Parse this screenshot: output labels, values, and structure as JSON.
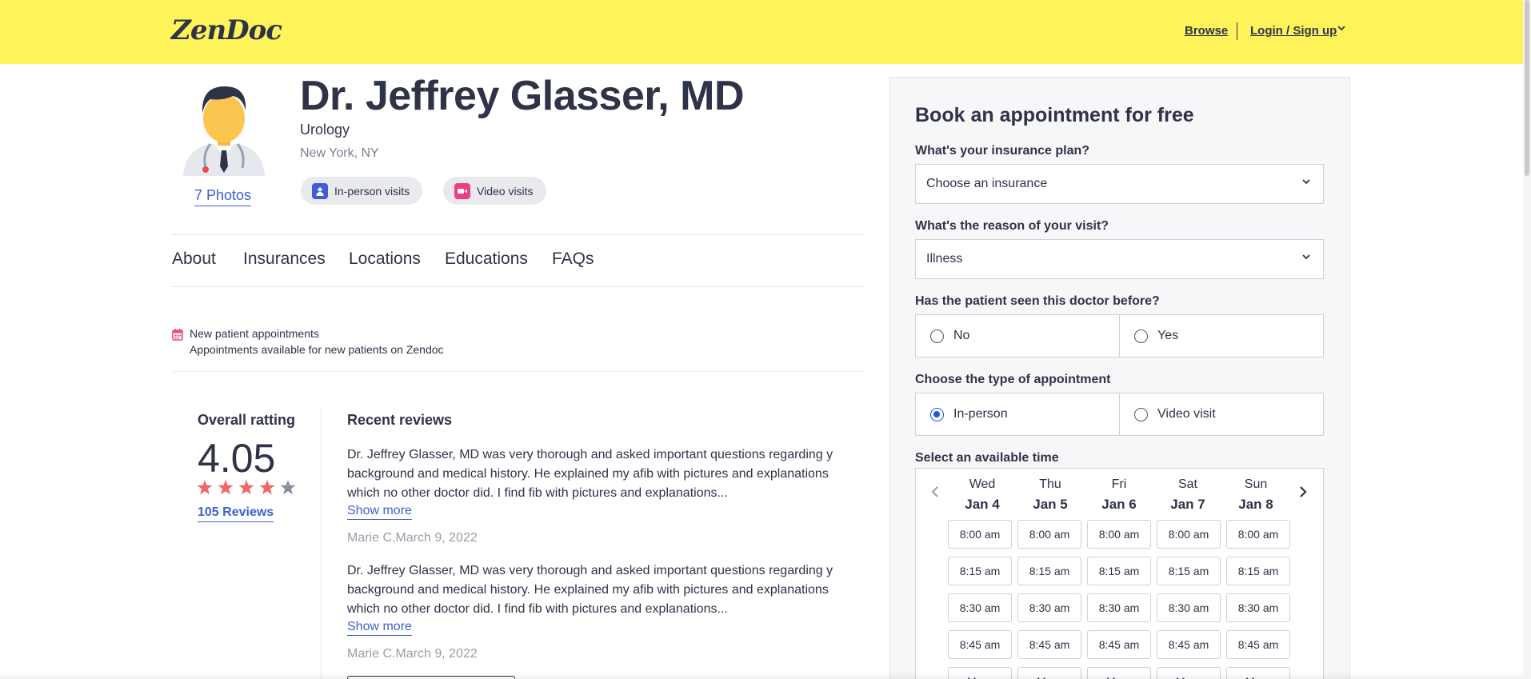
{
  "header": {
    "logo": "ZenDoc",
    "browse": "Browse",
    "login": "Login / Sign up"
  },
  "profile": {
    "name": "Dr. Jeffrey Glasser, MD",
    "specialty": "Urology",
    "location": "New York, NY",
    "photos": "7 Photos",
    "chips": [
      "In-person visits",
      "Video visits"
    ]
  },
  "tabs": [
    "About",
    "Insurances",
    "Locations",
    "Educations",
    "FAQs"
  ],
  "new_patient": {
    "title": "New patient appointments",
    "subtitle": "Appointments available for new patients on Zendoc"
  },
  "rating": {
    "title": "Overall ratting",
    "value": "4.05",
    "stars": 4,
    "max_stars": 5,
    "reviews_link": "105 Reviews"
  },
  "reviews": {
    "title": "Recent reviews",
    "items": [
      {
        "text": "Dr. Jeffrey Glasser, MD was very thorough and asked important questions regarding y background and medical history. He explained my afib with pictures and explanations which no other doctor did. I find fib with pictures and explanations...",
        "show_more": "Show more",
        "meta": "Marie C.March 9, 2022"
      },
      {
        "text": "Dr. Jeffrey Glasser, MD was very thorough and asked important questions regarding y background and medical history. He explained my afib with pictures and explanations which no other doctor did. I find fib with pictures and explanations...",
        "show_more": "Show more",
        "meta": "Marie C.March 9, 2022"
      }
    ]
  },
  "booking": {
    "title": "Book an appointment for free",
    "insurance_label": "What's your insurance plan?",
    "insurance_value": "Choose an insurance",
    "reason_label": "What's the reason of your visit?",
    "reason_value": "Illness",
    "seen_label": "Has the patient seen this doctor before?",
    "seen_options": [
      "No",
      "Yes"
    ],
    "type_label": "Choose the type of appointment",
    "type_options": [
      "In-person",
      "Video visit"
    ],
    "type_selected": "In-person",
    "time_label": "Select an available time",
    "days": [
      {
        "name": "Wed",
        "date": "Jan 4"
      },
      {
        "name": "Thu",
        "date": "Jan 5"
      },
      {
        "name": "Fri",
        "date": "Jan 6"
      },
      {
        "name": "Sat",
        "date": "Jan 7"
      },
      {
        "name": "Sun",
        "date": "Jan 8"
      }
    ],
    "slots": [
      "8:00 am",
      "8:15 am",
      "8:30 am",
      "8:45 am",
      "More"
    ]
  },
  "colors": {
    "header_bg": "#fff35a",
    "accent_blue": "#3d5fd3",
    "star_red": "#f06766",
    "star_gray": "#8a90a0",
    "video_pink": "#ec3f86",
    "calendar_pink": "#e94a8b"
  }
}
